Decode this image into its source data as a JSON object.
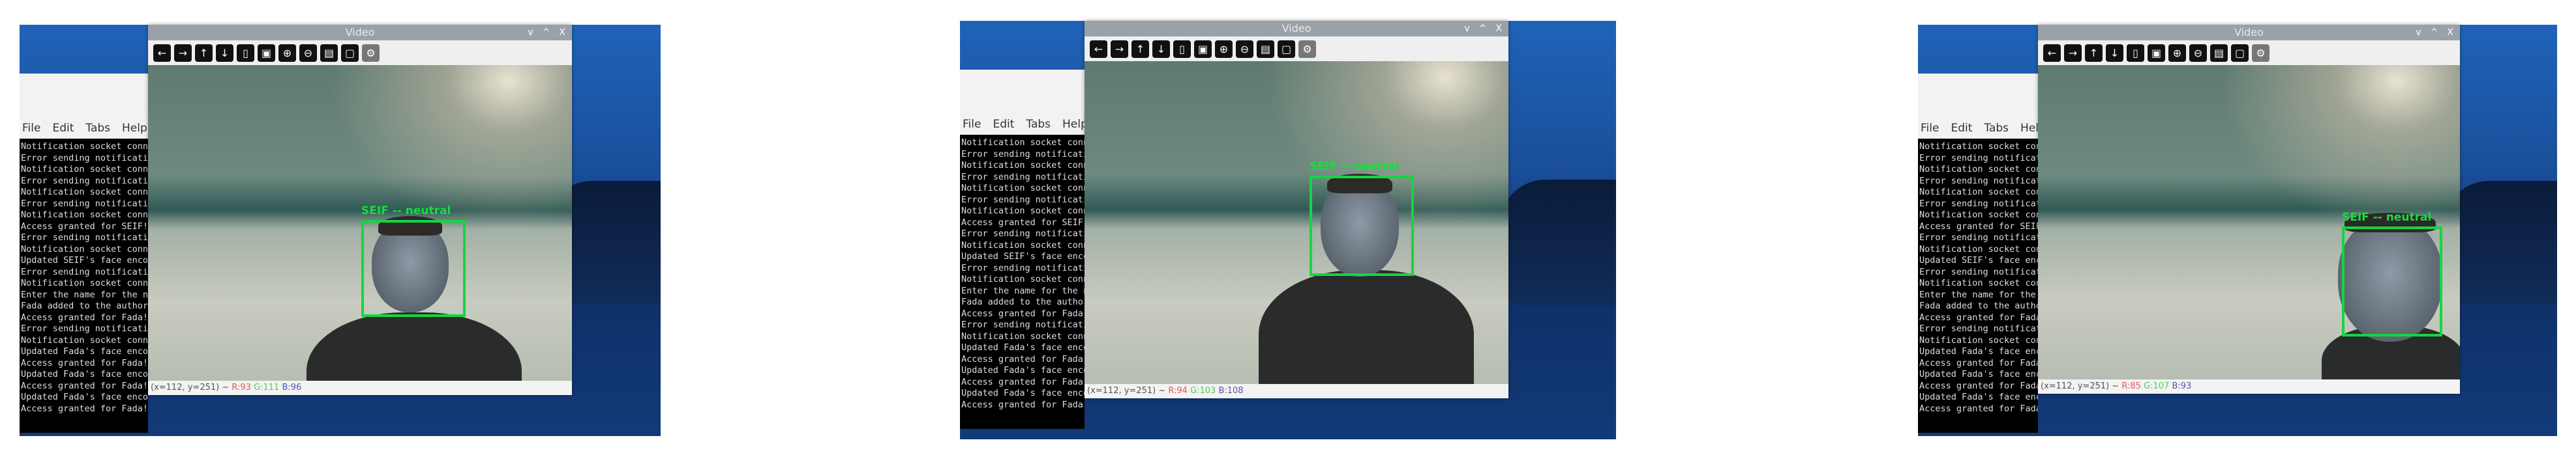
{
  "panels": [
    {
      "window_title": "Video",
      "terminal_menu": [
        "File",
        "Edit",
        "Tabs",
        "Help"
      ],
      "face_label": "SEIF -- neutral",
      "status": {
        "coords": "(x=112, y=251) ~",
        "r": "R:93",
        "g": "G:111",
        "b": "B:96"
      }
    },
    {
      "window_title": "Video",
      "terminal_menu": [
        "File",
        "Edit",
        "Tabs",
        "Help"
      ],
      "face_label": "SEIF -- neutral",
      "status": {
        "coords": "(x=112, y=251) ~",
        "r": "R:94",
        "g": "G:103",
        "b": "B:108"
      }
    },
    {
      "window_title": "Video",
      "terminal_menu": [
        "File",
        "Edit",
        "Tabs",
        "Help"
      ],
      "face_label": "SEIF -- neutral",
      "status": {
        "coords": "(x=112, y=251) ~",
        "r": "R:85",
        "g": "G:107",
        "b": "B:93"
      }
    }
  ],
  "terminal_lines": [
    "Notification socket conn",
    "Error sending notificati",
    "Notification socket conn",
    "Error sending notificati",
    "Notification socket conn",
    "Error sending notificati",
    "Notification socket conn",
    "Access granted for SEIF!",
    "Error sending notificati",
    "Notification socket conn",
    "Updated SEIF's face enco",
    "Error sending notificati",
    "Notification socket conn",
    "Enter the name for the n",
    "Fada added to the author",
    "Access granted for Fada!",
    "Error sending notificati",
    "Notification socket conn",
    "Updated Fada's face enco",
    "Access granted for Fada!",
    "Updated Fada's face enco",
    "Access granted for Fada!",
    "Updated Fada's face enco",
    "Access granted for Fada!"
  ],
  "window_controls": [
    "v",
    "^",
    "X"
  ],
  "toolbar_icons": [
    {
      "name": "arrow-left-icon",
      "glyph": "←"
    },
    {
      "name": "arrow-right-icon",
      "glyph": "→"
    },
    {
      "name": "arrow-up-icon",
      "glyph": "↑"
    },
    {
      "name": "arrow-down-icon",
      "glyph": "↓"
    },
    {
      "name": "zoom-fit-icon",
      "glyph": "▯"
    },
    {
      "name": "zoom-actual-icon",
      "glyph": "▣"
    },
    {
      "name": "zoom-in-icon",
      "glyph": "⊕"
    },
    {
      "name": "zoom-out-icon",
      "glyph": "⊖"
    },
    {
      "name": "save-icon",
      "glyph": "▤"
    },
    {
      "name": "copy-icon",
      "glyph": "▢"
    },
    {
      "name": "properties-icon",
      "glyph": "⚙"
    }
  ],
  "colors": {
    "detection_box": "#14d640"
  }
}
